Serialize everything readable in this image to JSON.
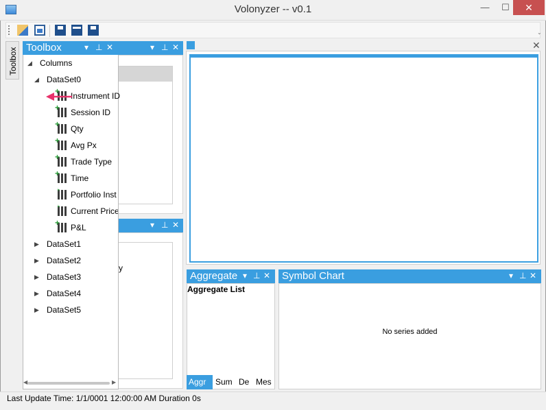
{
  "window": {
    "title": "Volonyzer -- v0.1",
    "minimize_glyph": "—",
    "maximize_glyph": "☐",
    "close_glyph": "✕"
  },
  "toolbar": {
    "icons": [
      "open-folder-icon",
      "import-icon",
      "save-icon",
      "save-layout-icon",
      "save-all-icon"
    ],
    "overflow_glyph": "⌄"
  },
  "side_tab": {
    "label": "Toolbox"
  },
  "toolbox": {
    "title": "Toolbox",
    "tree": {
      "root_label": "Columns",
      "dataset_expanded": "DataSet0",
      "columns": [
        "Instrument ID",
        "Session ID",
        "Qty",
        "Avg Px",
        "Trade Type",
        "Time",
        "Portfolio Inst",
        "Current Price",
        "P&L"
      ],
      "collapsed_datasets": [
        "DataSet1",
        "DataSet2",
        "DataSet3",
        "DataSet4",
        "DataSet5"
      ]
    }
  },
  "background_panel2": {
    "partial_text": "y"
  },
  "aggregate": {
    "title": "Aggregate",
    "list_title": "Aggregate List",
    "tabs": [
      "Aggr",
      "Sum",
      "De",
      "Mes"
    ]
  },
  "symbol_chart": {
    "title": "Symbol Chart",
    "empty_text": "No series added"
  },
  "panel_buttons": {
    "dropdown": "▾",
    "pin": "⊥",
    "close": "✕"
  },
  "status": {
    "text": "Last Update Time:  1/1/0001 12:00:00 AM  Duration 0s"
  },
  "colors": {
    "accent": "#3a9ee0",
    "annotation_arrow": "#e8336b"
  }
}
